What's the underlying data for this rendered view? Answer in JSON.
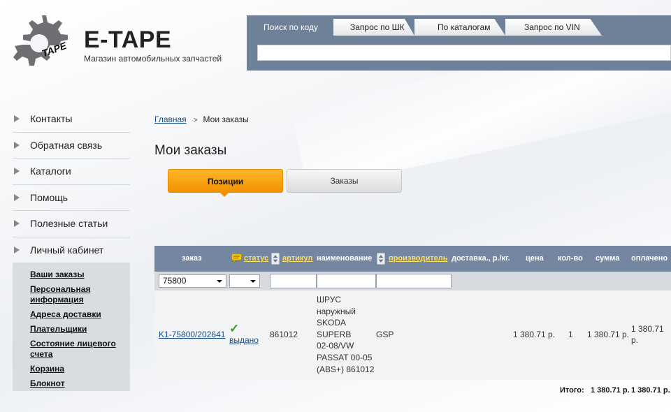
{
  "brand": {
    "title": "E-TAPE",
    "subtitle": "Магазин автомобильных запчастей",
    "gear_text": "TAPE"
  },
  "search": {
    "tabs": [
      "Поиск по коду",
      "Запрос по ШК",
      "По каталогам",
      "Запрос по VIN"
    ],
    "active_tab": "Поиск по коду",
    "input_value": ""
  },
  "sidebar": {
    "items": [
      {
        "label": "Контакты"
      },
      {
        "label": "Обратная связь"
      },
      {
        "label": "Каталоги"
      },
      {
        "label": "Помощь"
      },
      {
        "label": "Полезные статьи"
      },
      {
        "label": "Личный кабинет"
      }
    ],
    "submenu": [
      {
        "label": "Ваши заказы"
      },
      {
        "label": "Персональная информация"
      },
      {
        "label": "Адреса доставки"
      },
      {
        "label": "Плательщики"
      },
      {
        "label": "Состояние лицевого счета"
      },
      {
        "label": "Корзина"
      },
      {
        "label": "Блокнот"
      }
    ]
  },
  "breadcrumb": {
    "home": "Главная",
    "separator": ">",
    "current": "Мои заказы"
  },
  "page_title": "Мои заказы",
  "view_toggle": {
    "positions": "Позиции",
    "orders": "Заказы",
    "active": "Позиции"
  },
  "table": {
    "headers": {
      "order": "заказ",
      "status": "статус",
      "article": "артикул",
      "name": "наименование",
      "manufacturer": "производитель",
      "delivery": "доставка., р./кг.",
      "price": "цена",
      "qty": "кол-во",
      "sum": "сумма",
      "paid": "оплачено"
    },
    "filters": {
      "order_select": "75800",
      "status_select": ""
    },
    "rows": [
      {
        "order": "K1-75800/202641",
        "status": "выдано",
        "article": "861012",
        "name_lines": [
          "ШРУС",
          "наружный",
          "SKODA",
          "SUPERB",
          "02-08/VW",
          "PASSAT 00-05",
          "(ABS+) 861012"
        ],
        "manufacturer": "GSP",
        "delivery": "",
        "price": "1 380.71 р.",
        "qty": "1",
        "sum": "1 380.71 р.",
        "paid_line1": "1 380.71",
        "paid_line2": "р."
      }
    ],
    "totals": {
      "label": "Итого:",
      "sum": "1 380.71 р.",
      "paid": "1 380.71 р."
    }
  },
  "colors": {
    "header_bg": "#7586a0",
    "search_bg": "#6f8198",
    "accent_orange": "#f29100",
    "link_blue": "#1a4f8a",
    "header_link_yellow": "#ffe15a",
    "status_green": "#3a9a2a"
  }
}
